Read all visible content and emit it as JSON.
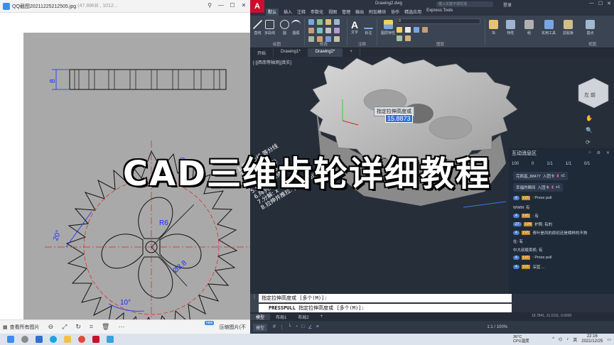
{
  "viewer": {
    "filename": "QQ截图20211225212505.jpg",
    "fileinfo": "(47.89KB , 1012...",
    "bottom_label": "查看所有图片",
    "bottom_right": "压缩图片(不",
    "dimensions": {
      "d1": "8",
      "d2": "16",
      "d3": "20°",
      "d4": "R6",
      "d5": "Ø3.8",
      "d6": "10°"
    }
  },
  "cad": {
    "logo": "A",
    "doc_title": "Drawing2.dwg",
    "search_placeholder": "键入关键字或短语",
    "login": "登录",
    "menus": [
      "默认",
      "插入",
      "注释",
      "参数化",
      "视图",
      "管理",
      "输出",
      "附加模块",
      "协作",
      "精选应用",
      "Express Tools"
    ],
    "ribbon": {
      "tools": [
        "直线",
        "多段线",
        "圆",
        "圆弧",
        "文字",
        "标注",
        "图层特性",
        "块",
        "特性",
        "组",
        "实用工具",
        "剪贴板",
        "基点"
      ],
      "groups": [
        "绘图",
        "修改",
        "注释",
        "图层",
        "视图"
      ],
      "layer_dropdown": "0"
    },
    "filetabs": [
      "开始",
      "Drawing1*",
      "Drawing2*"
    ],
    "viewport_label": "[-][西南等轴测][真实]",
    "dyn_prompt": "指定拉伸高度或",
    "dyn_value": "15.8873",
    "command_history": "指定拉伸高度或 [多个(M)]:",
    "command_name": "PRESSPULL",
    "command_prompt": "指定拉伸高度或 [多个(M)]:",
    "layout_tabs": [
      "模型",
      "布局1",
      "布局2"
    ],
    "status_model": "模型",
    "status_zoom": "1:1 / 100%",
    "status_coords": "18.7841, 21.0111, 0.0000"
  },
  "annotations": [
    "1.画中心线,等分线",
    "2.画圆",
    "3.画轮廓(修剪)",
    "4.倒圆角(两次)",
    "5.倒角:  按Z修改大小",
    "6.阵列: ar",
    "7.分解: x",
    "8.拉伸并推拉:  presspull"
  ],
  "panel": {
    "title": "互动消息区",
    "stats": [
      "100",
      "0",
      "1/1",
      "1/1",
      "0/1"
    ],
    "messages": [
      {
        "user": "完颜昌_88477",
        "text": "入团卡",
        "extra": "x1"
      },
      {
        "user": "幸福的瞬间",
        "text": "入团卡",
        "extra": "x1"
      },
      {
        "level": "4",
        "tag": "LV1",
        "text": ": Press pull"
      },
      {
        "text": "WWM: 有"
      },
      {
        "level": "4",
        "tag": "LV1",
        "text": ": 有"
      },
      {
        "level": "27",
        "tag": "LV4",
        "text": "护照: 有的"
      },
      {
        "level": "4",
        "tag": "LV1",
        "text": "青叶是风的原初还是榜样的不熟"
      },
      {
        "text": "在: 有"
      },
      {
        "text": "中大叔贩卖机: 有"
      },
      {
        "level": "4",
        "tag": "LV1",
        "text": ": Press pull"
      },
      {
        "level": "4",
        "tag": "LV1",
        "text": "深蓝 ..."
      }
    ]
  },
  "overlay_title": "CAD三维齿轮详细教程",
  "taskbar": {
    "weather_temp": "36°C",
    "weather_label": "CPU温度",
    "ime": "英",
    "time": "22:16",
    "date": "2021/12/25"
  },
  "colors": {
    "cad_bg": "#262e3a",
    "drawing_bg": "#a9a9a9",
    "dimension_blue": "#1a2cff",
    "centerline_red": "#e02020",
    "annotation_text": "#ffffff",
    "autocad_red": "#c8102e"
  }
}
